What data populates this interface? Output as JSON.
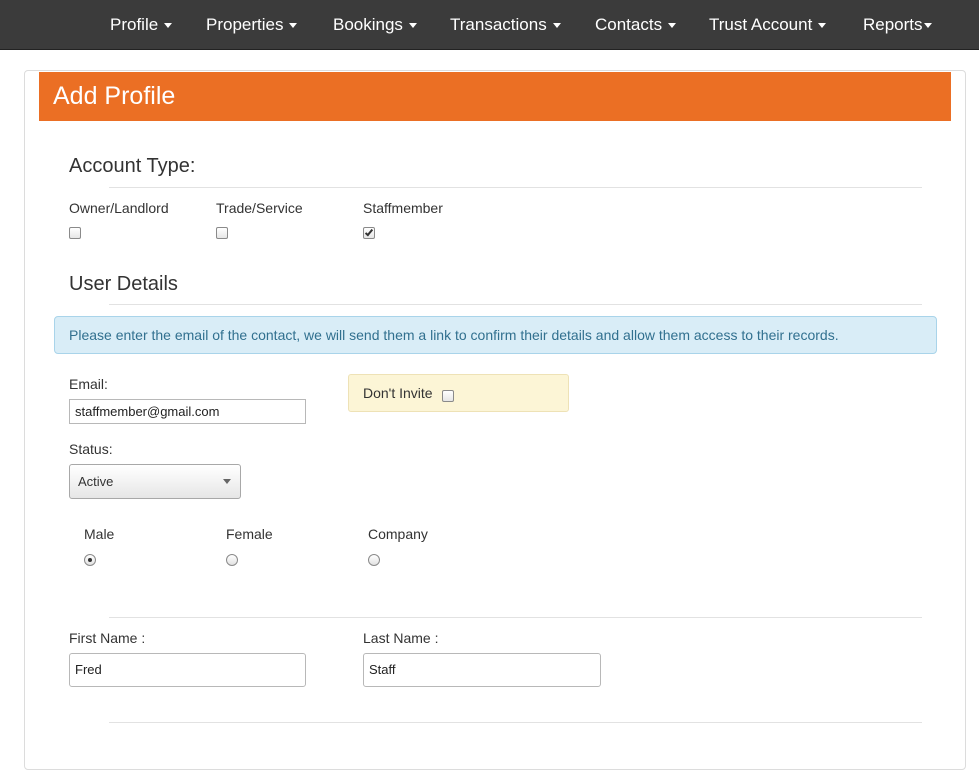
{
  "nav": {
    "items": [
      {
        "label": "Profile"
      },
      {
        "label": "Properties"
      },
      {
        "label": "Bookings"
      },
      {
        "label": "Transactions"
      },
      {
        "label": "Contacts"
      },
      {
        "label": "Trust Account"
      },
      {
        "label": "Reports"
      }
    ]
  },
  "page": {
    "title": "Add Profile"
  },
  "account_type": {
    "heading": "Account Type:",
    "options": [
      {
        "label": "Owner/Landlord",
        "checked": false
      },
      {
        "label": "Trade/Service",
        "checked": false
      },
      {
        "label": "Staffmember",
        "checked": true
      }
    ]
  },
  "user_details": {
    "heading": "User Details",
    "info_text": "Please enter the email of the contact, we will send them a link to confirm their details and allow them access to their records.",
    "email_label": "Email:",
    "email_value": "staffmember@gmail.com",
    "dont_invite_label": "Don't Invite",
    "dont_invite_checked": false,
    "status_label": "Status:",
    "status_value": "Active",
    "gender_options": [
      {
        "label": "Male",
        "selected": true
      },
      {
        "label": "Female",
        "selected": false
      },
      {
        "label": "Company",
        "selected": false
      }
    ],
    "first_name_label": "First Name :",
    "first_name_value": "Fred",
    "last_name_label": "Last Name :",
    "last_name_value": "Staff"
  },
  "colors": {
    "navbar_bg": "#3b3b3b",
    "header_accent": "#eb6f24",
    "info_bg": "#d9edf7",
    "info_text": "#31708f",
    "warning_bg": "#fcf5d6"
  }
}
